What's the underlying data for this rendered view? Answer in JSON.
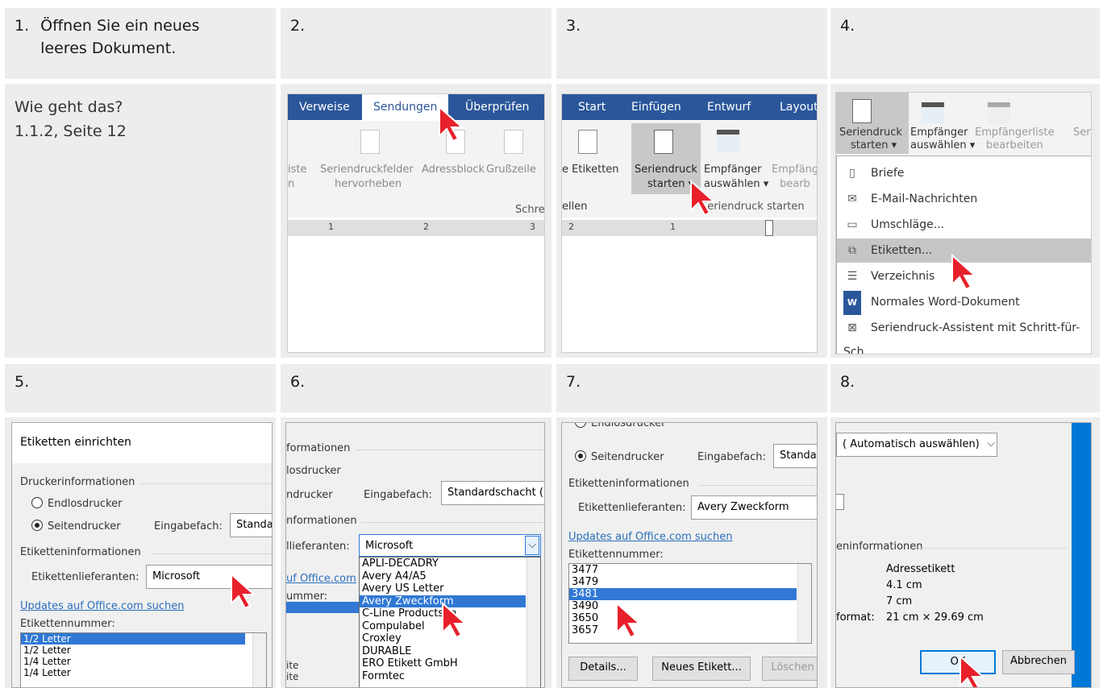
{
  "headers": {
    "h1": {
      "num": "1.",
      "text1": "Öffnen Sie ein neues",
      "text2": "leeres Dokument."
    },
    "h2": "2.",
    "h3": "3.",
    "h4": "4.",
    "h5": "5.",
    "h6": "6.",
    "h7": "7.",
    "h8": "8."
  },
  "p1": {
    "line1": "Wie geht das?",
    "line2": "1.1.2, Seite 12"
  },
  "p2": {
    "tabs": [
      "Verweise",
      "Sendungen",
      "Überprüfen"
    ],
    "btn_liste": "iste",
    "btn_liste2": "n",
    "btn_fields1": "Seriendruckfelder",
    "btn_fields2": "hervorheben",
    "btn_adress": "Adressblock",
    "btn_gruss": "Grußzeile",
    "group": "Schre",
    "ruler": [
      "1",
      "2",
      "3"
    ]
  },
  "p3": {
    "tabs": [
      "Start",
      "Einfügen",
      "Entwurf",
      "Layout"
    ],
    "etiketten": "e Etiketten",
    "ellen": "ellen",
    "sd1": "Seriendruck",
    "sd2": "starten ▾",
    "emp1": "Empfänger",
    "emp2": "auswählen ▾",
    "emp3": "Empfäng",
    "emp4": "bearb",
    "group": "Seriendruck starten",
    "ruler": [
      "2",
      "1"
    ]
  },
  "p4": {
    "b1a": "Seriendruck",
    "b1b": "starten ▾",
    "b2a": "Empfänger",
    "b2b": "auswählen ▾",
    "b3a": "Empfängerliste",
    "b3b": "bearbeiten",
    "b4": "Ser",
    "menu": [
      "Briefe",
      "E-Mail-Nachrichten",
      "Umschläge...",
      "Etiketten...",
      "Verzeichnis",
      "Normales Word-Dokument",
      "Seriendruck-Assistent mit Schritt-für-Sch"
    ]
  },
  "p5": {
    "title": "Etiketten einrichten",
    "printer": "Druckerinformationen",
    "endlos": "Endlosdrucker",
    "seiten": "Seitendrucker",
    "fach_label": "Eingabefach:",
    "fach_value": "Standar",
    "labelinfo": "Etiketteninformationen",
    "vendor_label": "Etikettenlieferanten:",
    "vendor_value": "Microsoft",
    "updates": "Updates auf Office.com suchen",
    "nr_label": "Etikettennummer:",
    "list": [
      "1/2 Letter",
      "1/2 Letter",
      "1/4 Letter",
      "1/4 Letter"
    ]
  },
  "p6": {
    "info": "formationen",
    "endlos": "losdrucker",
    "seiten": "ndrucker",
    "fach_label": "Eingabefach:",
    "fach_value": "Standardschacht (.",
    "labelinfo": "nformationen",
    "vendor_label": "llieferanten:",
    "vendor_value": "Microsoft",
    "link": "uf Office.com",
    "nr": "ummer:",
    "ite1": "ite",
    "ite2": "ite",
    "options": [
      "APLI-DECADRY",
      "Avery A4/A5",
      "Avery US Letter",
      "Avery Zweckform",
      "C-Line Products In",
      "Compulabel",
      "Croxley",
      "DURABLE",
      "ERO Etikett GmbH",
      "Formtec"
    ]
  },
  "p7": {
    "top": "Endlosdrucker",
    "seiten": "Seitendrucker",
    "fach_label": "Eingabefach:",
    "fach_value": "Standar",
    "labelinfo": "Etiketteninformationen",
    "vendor_label": "Etikettenlieferanten:",
    "vendor_value": "Avery Zweckform",
    "updates": "Updates auf Office.com suchen",
    "nr_label": "Etikettennummer:",
    "list": [
      "3477",
      "3479",
      "3481",
      "3490",
      "3650",
      "3657"
    ],
    "details": "Details...",
    "neues": "Neues Etikett...",
    "loeschen": "Löschen"
  },
  "p8": {
    "select": "( Automatisch auswählen)",
    "info": "eninformationen",
    "type": "Adressetikett",
    "height": "4.1 cm",
    "width": "7 cm",
    "format_label": "format:",
    "format_value": "21 cm × 29.69 cm",
    "ok": "OK",
    "cancel": "Abbrechen"
  }
}
